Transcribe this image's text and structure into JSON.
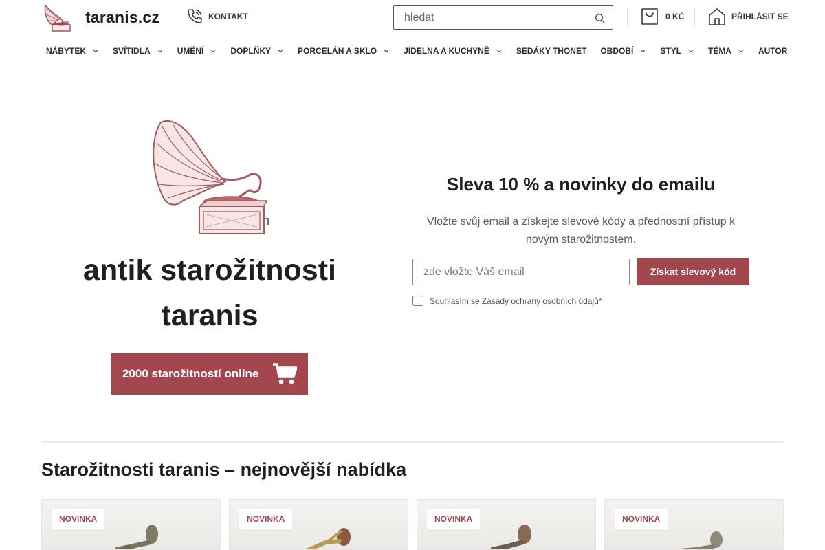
{
  "header": {
    "site_name": "taranis.cz",
    "contact_label": "KONTAKT",
    "search_placeholder": "hledat",
    "cart_total": "0 KČ",
    "login_label": "PŘIHLÁSIT SE"
  },
  "nav": [
    {
      "label": "NÁBYTEK",
      "dropdown": true
    },
    {
      "label": "SVÍTIDLA",
      "dropdown": true
    },
    {
      "label": "UMĚNÍ",
      "dropdown": true
    },
    {
      "label": "DOPLŇKY",
      "dropdown": true
    },
    {
      "label": "PORCELÁN A SKLO",
      "dropdown": true
    },
    {
      "label": "JÍDELNA A KUCHYNĚ",
      "dropdown": true
    },
    {
      "label": "SEDÁKY THONET",
      "dropdown": false
    },
    {
      "label": "OBDOBÍ",
      "dropdown": true
    },
    {
      "label": "STYL",
      "dropdown": true
    },
    {
      "label": "TÉMA",
      "dropdown": true
    },
    {
      "label": "AUTOR",
      "dropdown": false
    }
  ],
  "hero": {
    "title_line1": "antik starožitnosti",
    "title_line2": "taranis",
    "button_label": "2000 starožitností online",
    "image_icon": "gramophone-icon"
  },
  "promo": {
    "title": "Sleva 10 % a novinky do emailu",
    "text": "Vložte svůj email a získejte slevové kódy a přednostní přístup k novým starožitnostem.",
    "email_placeholder": "zde vložte Váš email",
    "submit_label": "Získat slevový kód",
    "consent_prefix": "Souhlasím se",
    "consent_link": "Zásady ochrany osobních údajů",
    "consent_required": "*"
  },
  "section": {
    "title": "Starožitnosti taranis – nejnovější nabídka"
  },
  "products": [
    {
      "badge": "NOVINKA"
    },
    {
      "badge": "NOVINKA"
    },
    {
      "badge": "NOVINKA"
    },
    {
      "badge": "NOVINKA"
    }
  ],
  "colors": {
    "accent": "#a3474f",
    "text": "#1f1f1f",
    "muted": "#5a5a5a"
  }
}
